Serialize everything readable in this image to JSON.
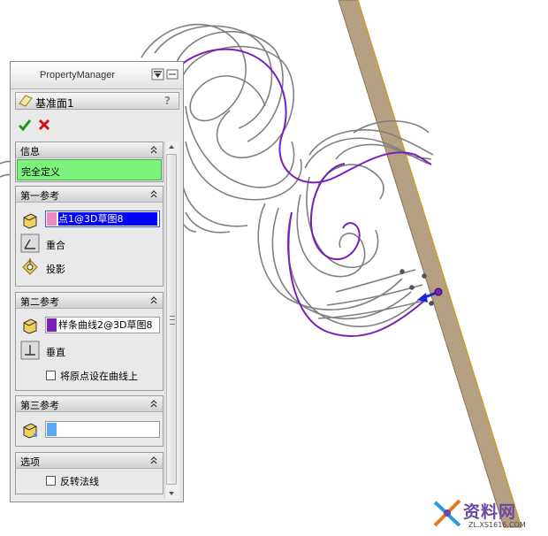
{
  "panel": {
    "title": "PropertyManager",
    "feature_title": "基准面1",
    "help": "?"
  },
  "info": {
    "header": "信息",
    "status": "完全定义"
  },
  "ref1": {
    "header": "第一参考",
    "selection": "点1@3D草图8",
    "opt1": "重合",
    "opt2": "投影"
  },
  "ref2": {
    "header": "第二参考",
    "selection": "样条曲线2@3D草图8",
    "opt1": "垂直",
    "checkbox": "将原点设在曲线上"
  },
  "ref3": {
    "header": "第三参考",
    "selection": ""
  },
  "options": {
    "header": "选项",
    "checkbox": "反转法线"
  },
  "watermark": {
    "main": "资料网",
    "sub": "ZL.XS1616.COM"
  },
  "colors": {
    "plank": "#b5a084",
    "curve_gray": "#808080",
    "curve_purple": "#7a1fb8",
    "status_green": "#7cf27c",
    "selection_blue": "#0000ff"
  }
}
